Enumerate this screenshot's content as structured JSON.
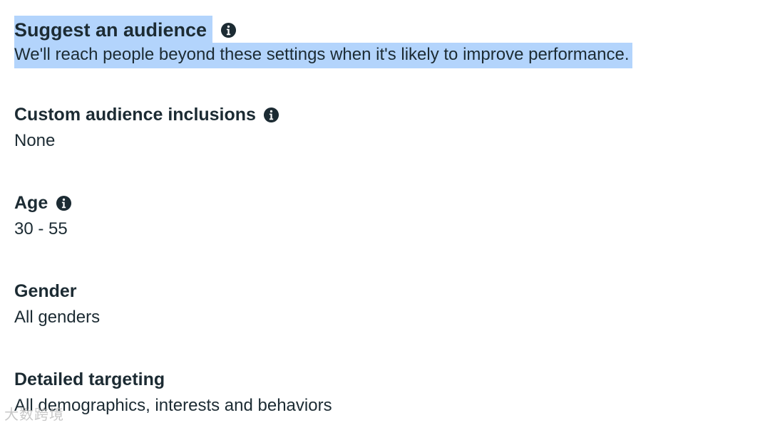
{
  "suggest": {
    "title": "Suggest an audience",
    "description": "We'll reach people beyond these settings when it's likely to improve performance.",
    "info_icon": "info-circle-icon"
  },
  "custom_audience": {
    "title": "Custom audience inclusions",
    "value": "None",
    "info_icon": "info-circle-icon"
  },
  "age": {
    "title": "Age",
    "value": "30 - 55",
    "info_icon": "info-circle-icon"
  },
  "gender": {
    "title": "Gender",
    "value": "All genders"
  },
  "detailed_targeting": {
    "title": "Detailed targeting",
    "value": "All demographics, interests and behaviors"
  },
  "watermark": {
    "text": "大数跨境"
  },
  "colors": {
    "text": "#1c2b33",
    "selection_highlight": "#b3d4fc",
    "background": "#ffffff"
  }
}
